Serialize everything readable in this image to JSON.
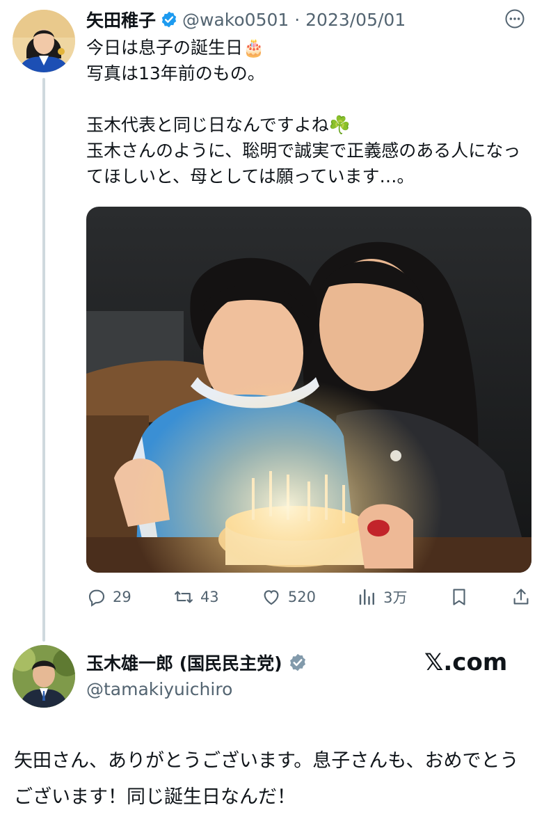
{
  "tweet": {
    "author_name": "矢田稚子",
    "handle_date": "@wako0501 · 2023/05/01",
    "text_lines": "今日は息子の誕生日🎂\n写真は13年前のもの。\n\n玉木代表と同じ日なんですよね☘️\n玉木さんのように、聡明で誠実で正義感のある人になってほしいと、母としては願っています…。",
    "photo_alt": "誕生日ケーキの前の息子と母の写真",
    "actions": {
      "replies": "29",
      "reposts": "43",
      "likes": "520",
      "views": "3万"
    }
  },
  "reply": {
    "author_name": "玉木雄一郎 (国民民主党)",
    "handle": "@tamakiyuichiro",
    "site_label": "𝕏.com",
    "text": "矢田さん、ありがとうございます。息子さんも、おめでとうございます！同じ誕生日なんだ！"
  },
  "colors": {
    "verified_blue": "#1d9bf0",
    "verified_grey": "#829aab",
    "muted": "#536471",
    "thread_line": "#cfd9de"
  },
  "icons": [
    "verified-badge-icon",
    "more-icon",
    "reply-icon",
    "repost-icon",
    "like-icon",
    "views-icon",
    "bookmark-icon",
    "share-icon",
    "verified-grey-badge-icon"
  ]
}
